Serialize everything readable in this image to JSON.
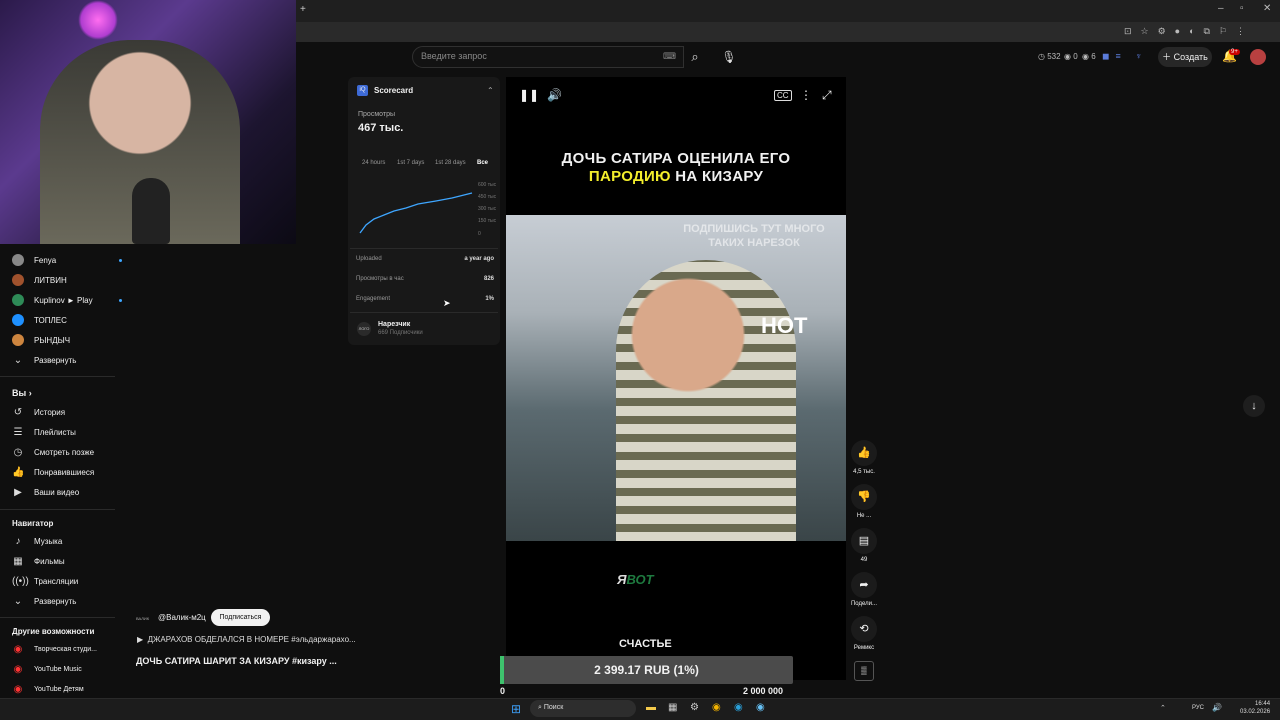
{
  "browser": {
    "new_tab": "+",
    "win_min": "–",
    "win_max": "▫",
    "win_close": "✕"
  },
  "header": {
    "search_placeholder": "Введите запрос",
    "stats": [
      "532",
      "0",
      "6"
    ],
    "create_label": "Создать",
    "bell_badge": "9+"
  },
  "sidebar": {
    "subscriptions": [
      {
        "label": "Fenya",
        "color": "#888888",
        "dot": true
      },
      {
        "label": "ЛИТВИН",
        "color": "#a0522d",
        "dot": false
      },
      {
        "label": "Kuplinov ► Play",
        "color": "#2e8b57",
        "dot": true
      },
      {
        "label": "ТОПЛЕС",
        "color": "#1e90ff",
        "dot": false
      },
      {
        "label": "РЫНДЫЧ",
        "color": "#cd853f",
        "dot": false
      }
    ],
    "expand_label": "Развернуть",
    "you_label": "Вы",
    "you_items": [
      "История",
      "Плейлисты",
      "Смотреть позже",
      "Понравившиеся",
      "Ваши видео"
    ],
    "nav_label": "Навигатор",
    "nav_items": [
      "Музыка",
      "Фильмы",
      "Трансляции"
    ],
    "nav_expand": "Развернуть",
    "other_label": "Другие возможности",
    "other_items": [
      "Творческая студи...",
      "YouTube Music",
      "YouTube Детям"
    ]
  },
  "scorecard": {
    "title": "Scorecard",
    "views_label": "Просмотры",
    "views_value": "467 тыс.",
    "tabs": [
      "24 hours",
      "1st 7 days",
      "1st 28 days",
      "Все"
    ],
    "y_ticks": [
      "600 тыс",
      "450 тыс",
      "300 тыс",
      "150 тыс",
      "0"
    ],
    "rows": [
      {
        "label": "Uploaded",
        "value": "a year ago"
      },
      {
        "label": "Просмотры в час",
        "value": "826"
      },
      {
        "label": "Engagement",
        "value": "1%"
      }
    ],
    "channel_name": "Нарезчик",
    "channel_subs": "669 Подписчики",
    "channel_logo": "ЛОГО"
  },
  "video": {
    "caption_line1": "ДОЧЬ САТИРА ОЦЕНИЛА ЕГО",
    "caption_highlight": "ПАРОДИЮ",
    "caption_line2_rest": " НА КИЗАРУ",
    "frame_overlay": "ПОДПИШИСЬ ТУТ МНОГО ТАКИХ НАРЕЗОК",
    "sign_text": "HOT",
    "subtitle_a": "Я",
    "subtitle_b": "ВОТ",
    "subtitle_bottom": "СЧАСТЬЕ",
    "cc": "CC"
  },
  "donation": {
    "amount": "2 399.17 RUB (1%)",
    "min": "0",
    "max": "2 000 000",
    "progress": 0.01,
    "fill_color": "#3ec26d"
  },
  "actions": {
    "like_count": "4,5 тыс.",
    "dislike": "Не ...",
    "comments": "49",
    "share": "Подели...",
    "remix": "Ремикс"
  },
  "overlay": {
    "channel_handle": "@Валик-м2ц",
    "subscribe": "Подписаться",
    "link_text": "ДЖАРАХОВ ОБДЕЛАЛСЯ В НОМЕРЕ #эльдаржарахо...",
    "title": "ДОЧЬ САТИРА ШАРИТ ЗА КИЗАРУ #кизару ...",
    "avatar_text": "ВАЛИК"
  },
  "taskbar": {
    "search": "Поиск",
    "lang": "РУС",
    "time": "16:44",
    "date": "03.02.2026"
  }
}
